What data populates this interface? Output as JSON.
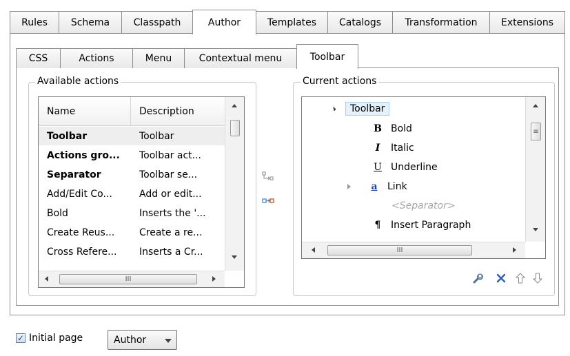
{
  "top_tabs": [
    {
      "label": "Rules"
    },
    {
      "label": "Schema"
    },
    {
      "label": "Classpath"
    },
    {
      "label": "Author",
      "active": true
    },
    {
      "label": "Templates"
    },
    {
      "label": "Catalogs"
    },
    {
      "label": "Transformation"
    },
    {
      "label": "Extensions"
    }
  ],
  "inner_tabs": [
    {
      "label": "CSS"
    },
    {
      "label": "Actions"
    },
    {
      "label": "Menu"
    },
    {
      "label": "Contextual menu"
    },
    {
      "label": "Toolbar",
      "active": true
    }
  ],
  "available": {
    "title": "Available actions",
    "columns": [
      "Name",
      "Description"
    ],
    "rows": [
      {
        "name": "Toolbar",
        "desc": "Toolbar",
        "bold": true,
        "selected": true
      },
      {
        "name": "Actions gro...",
        "desc": "Toolbar act...",
        "bold": true
      },
      {
        "name": "Separator",
        "desc": "Toolbar se...",
        "bold": true
      },
      {
        "name": "Add/Edit Co...",
        "desc": "Add or edit...",
        "bold": false
      },
      {
        "name": "Bold",
        "desc": "Inserts the '...",
        "bold": false
      },
      {
        "name": "Create Reus...",
        "desc": "Create a re...",
        "bold": false
      },
      {
        "name": "Cross Refere...",
        "desc": "Inserts a Cr...",
        "bold": false
      }
    ],
    "hscroll_grip": "III"
  },
  "current": {
    "title": "Current actions",
    "nodes": [
      {
        "label": "Toolbar",
        "icon": "",
        "expander": "expanded-triangle",
        "selected": true
      },
      {
        "label": "Bold",
        "icon": "B",
        "icon_name": "bold-icon"
      },
      {
        "label": "Italic",
        "icon": "I",
        "icon_name": "italic-icon"
      },
      {
        "label": "Underline",
        "icon": "U",
        "icon_name": "underline-icon"
      },
      {
        "label": "Link",
        "icon": "a",
        "icon_name": "link-icon",
        "expander": "collapsed-triangle"
      },
      {
        "label": "<Separator>",
        "separator": true
      },
      {
        "label": "Insert Paragraph",
        "icon": "¶",
        "icon_name": "paragraph-icon"
      }
    ],
    "hscroll_grip": "III",
    "tools": [
      "wrench-icon",
      "delete-icon",
      "move-up-icon",
      "move-down-icon"
    ]
  },
  "bottom": {
    "initial_page_label": "Initial page",
    "initial_page_checked": true,
    "initial_page_value": "Author"
  },
  "colors": {
    "delete_blue": "#2b5db8",
    "move_orange": "#e05a1f",
    "move_blue": "#3d7fd6",
    "selection_fill": "#e6f2fb"
  }
}
